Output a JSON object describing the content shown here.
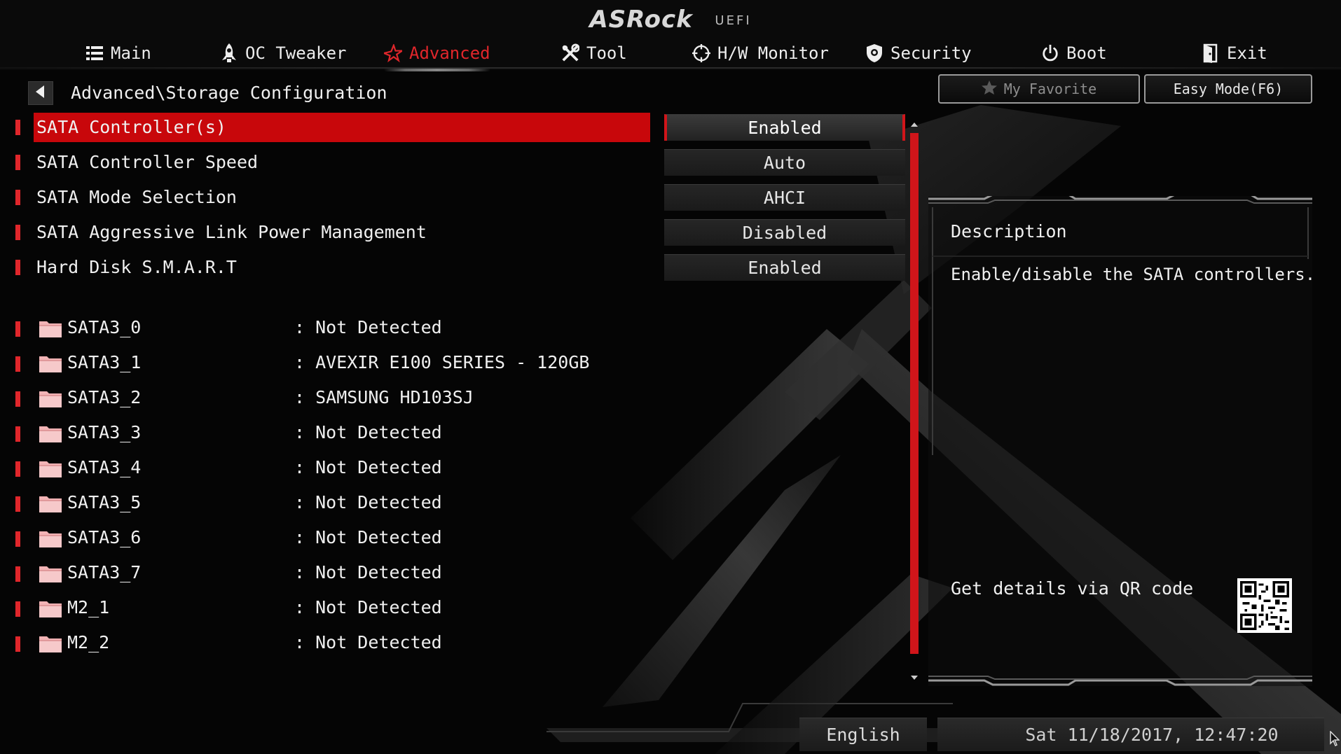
{
  "brand": {
    "logo": "ASRock",
    "sub": "UEFI"
  },
  "nav": {
    "tabs": [
      {
        "label": "Main",
        "icon": "list-icon"
      },
      {
        "label": "OC Tweaker",
        "icon": "rocket-icon"
      },
      {
        "label": "Advanced",
        "icon": "star-icon",
        "active": true
      },
      {
        "label": "Tool",
        "icon": "tools-icon"
      },
      {
        "label": "H/W Monitor",
        "icon": "monitor-icon"
      },
      {
        "label": "Security",
        "icon": "shield-icon"
      },
      {
        "label": "Boot",
        "icon": "power-icon"
      },
      {
        "label": "Exit",
        "icon": "exit-icon"
      }
    ]
  },
  "breadcrumb": "Advanced\\Storage Configuration",
  "buttons": {
    "favorite": "My Favorite",
    "easy_mode": "Easy Mode(F6)"
  },
  "settings": [
    {
      "label": "SATA Controller(s)",
      "value": "Enabled",
      "selected": true
    },
    {
      "label": "SATA Controller Speed",
      "value": "Auto"
    },
    {
      "label": "SATA Mode Selection",
      "value": "AHCI"
    },
    {
      "label": "SATA Aggressive Link Power Management",
      "value": "Disabled"
    },
    {
      "label": "Hard Disk S.M.A.R.T",
      "value": "Enabled"
    }
  ],
  "drives": [
    {
      "name": "SATA3_0",
      "value": ": Not Detected"
    },
    {
      "name": "SATA3_1",
      "value": ": AVEXIR E100 SERIES - 120GB"
    },
    {
      "name": "SATA3_2",
      "value": ": SAMSUNG HD103SJ"
    },
    {
      "name": "SATA3_3",
      "value": ": Not Detected"
    },
    {
      "name": "SATA3_4",
      "value": ": Not Detected"
    },
    {
      "name": "SATA3_5",
      "value": ": Not Detected"
    },
    {
      "name": "SATA3_6",
      "value": ": Not Detected"
    },
    {
      "name": "SATA3_7",
      "value": ": Not Detected"
    },
    {
      "name": "M2_1",
      "value": ": Not Detected"
    },
    {
      "name": "M2_2",
      "value": ": Not Detected"
    }
  ],
  "description": {
    "title": "Description",
    "text": "Enable/disable the SATA controllers.",
    "qr_label": "Get details via QR code"
  },
  "footer": {
    "language": "English",
    "datetime": "Sat 11/18/2017, 12:47:20"
  },
  "colors": {
    "accent": "#d0151a",
    "background": "#050505",
    "text": "#f0f0f0"
  }
}
